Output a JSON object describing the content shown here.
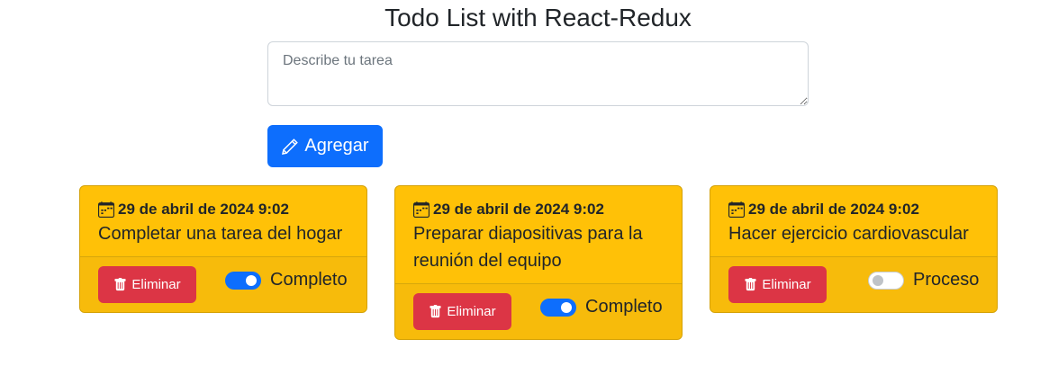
{
  "header": {
    "title": "Todo List with React-Redux"
  },
  "form": {
    "placeholder": "Describe tu tarea",
    "value": "",
    "add_label": "Agregar",
    "add_icon": "pencil-icon",
    "add_color": "#0d6efd"
  },
  "cards": [
    {
      "date": "29 de abril de 2024 9:02",
      "description": "Completar una tarea del hogar",
      "delete_label": "Eliminar",
      "status_label": "Completo",
      "completed": true
    },
    {
      "date": "29 de abril de 2024 9:02",
      "description": "Preparar diapositivas para la reunión del equipo",
      "delete_label": "Eliminar",
      "status_label": "Completo",
      "completed": true
    },
    {
      "date": "29 de abril de 2024 9:02",
      "description": "Hacer ejercicio cardiovascular",
      "delete_label": "Eliminar",
      "status_label": "Proceso",
      "completed": false
    }
  ],
  "colors": {
    "card_bg": "#ffc107",
    "delete_bg": "#dc3545",
    "switch_on": "#0d6efd"
  },
  "icons": {
    "date": "calendar-icon",
    "delete": "trash-icon"
  }
}
